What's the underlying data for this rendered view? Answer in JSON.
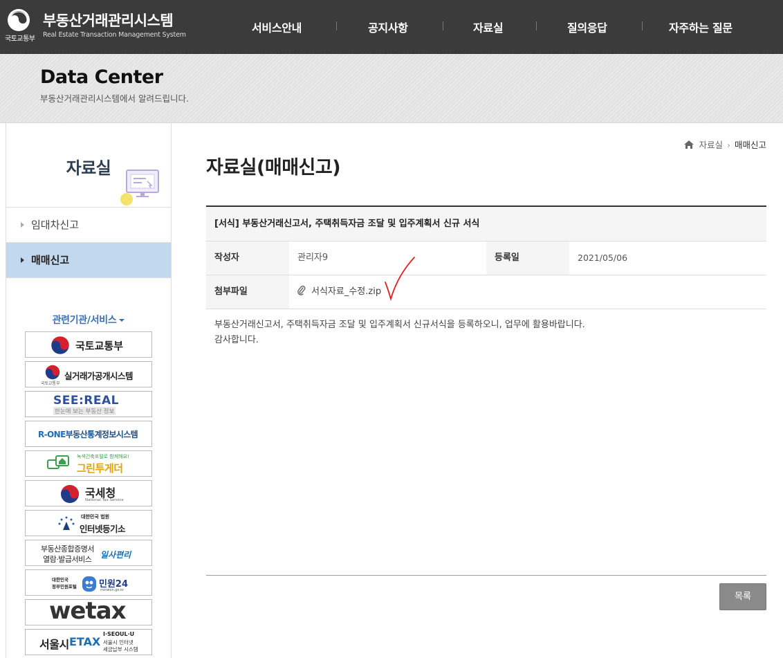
{
  "header": {
    "ministry_name": "국토교통부",
    "site_title": "부동산거래관리시스템",
    "site_subtitle": "Real Estate Transaction Management System",
    "nav": [
      {
        "label": "서비스안내"
      },
      {
        "label": "공지사항"
      },
      {
        "label": "자료실"
      },
      {
        "label": "질의응답"
      },
      {
        "label": "자주하는 질문"
      }
    ]
  },
  "visual": {
    "title": "Data Center",
    "subtitle": "부동산거래관리시스템에서 알려드립니다."
  },
  "sidebar": {
    "title": "자료실",
    "menu": [
      {
        "label": "임대차신고",
        "active": false
      },
      {
        "label": "매매신고",
        "active": true
      }
    ],
    "related_label": "관련기관/서비스",
    "banners": {
      "molit": {
        "name": "국토교통부"
      },
      "rtms": {
        "name": "실거래가공개시스템",
        "sub": "국토교통부"
      },
      "seereal": {
        "name": "SEE:REAL",
        "sub": "한눈에 보는 부동산 정보"
      },
      "rone": {
        "prefix": "R-",
        "brand": "ONE",
        "name": "부동산통계정보시스템"
      },
      "green": {
        "tagline": "녹색건축포털로 함께해요!",
        "name": "그린투게더"
      },
      "nts": {
        "name": "국세청",
        "sub": "National Tax Service"
      },
      "iros": {
        "court": "대한민국 법원",
        "name": "인터넷등기소"
      },
      "kras": {
        "line1": "부동산종합증명서",
        "line2": "열람·발급서비스",
        "brand": "일사편리"
      },
      "minwon": {
        "line1": "대한민국",
        "line2": "정부민원포털",
        "name": "민원24",
        "url": "minwon.go.kr"
      },
      "wetax": {
        "name": "wetax"
      },
      "etax": {
        "city": "서울시",
        "name": "ETAX",
        "brand": "I·SEOUL·U",
        "desc1": "서울시 인터넷",
        "desc2": "세금납부 시스템"
      }
    }
  },
  "breadcrumb": {
    "items": [
      "자료실",
      "매매신고"
    ]
  },
  "page_title": "자료실(매매신고)",
  "post": {
    "subject": "[서식] 부동산거래신고서, 주택취득자금 조달 및 입주계획서 신규 서식",
    "author_label": "작성자",
    "author": "관리자9",
    "date_label": "등록일",
    "date": "2021/05/06",
    "attach_label": "첨부파일",
    "attachment": "서식자료_수정.zip",
    "body_lines": [
      "부동산거래신고서, 주택취득자금 조달 및 입주계획서 신규서식을 등록하오니, 업무에 활용바랍니다.",
      "감사합니다."
    ]
  },
  "list_button": "목록",
  "colors": {
    "header_bg": "#3b3b3b",
    "active_menu_bg": "#c2d8ee",
    "related_link": "#3a6fb5",
    "annotation_red": "#e02020"
  }
}
